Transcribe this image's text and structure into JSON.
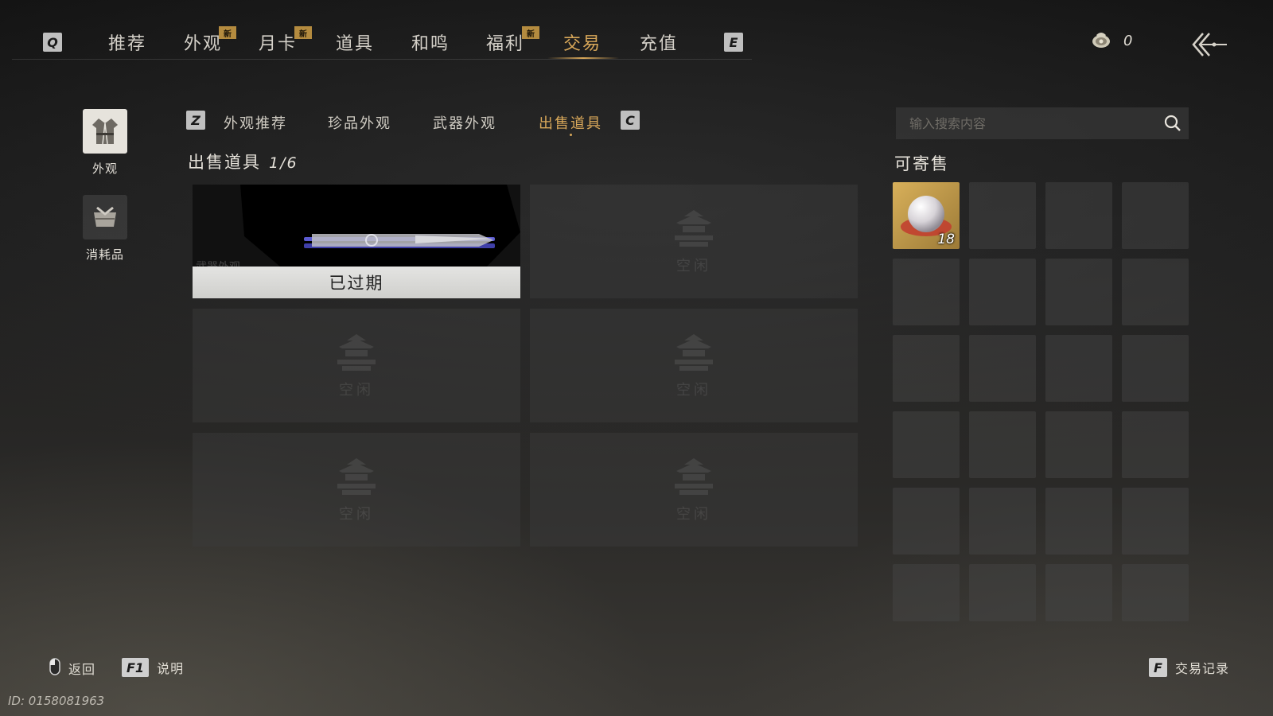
{
  "nav": {
    "left_key": "Q",
    "right_key": "E",
    "tabs": [
      {
        "label": "推荐",
        "badge": ""
      },
      {
        "label": "外观",
        "badge": "新"
      },
      {
        "label": "月卡",
        "badge": "新"
      },
      {
        "label": "道具",
        "badge": ""
      },
      {
        "label": "和鸣",
        "badge": ""
      },
      {
        "label": "福利",
        "badge": "新"
      },
      {
        "label": "交易",
        "badge": ""
      },
      {
        "label": "充值",
        "badge": ""
      }
    ],
    "active_tab": "交易",
    "currency_icon": "coin-pouch-icon",
    "currency_value": "0",
    "back_icon": "back-arrow-icon"
  },
  "sidebar": {
    "items": [
      {
        "label": "外观",
        "icon": "robe-icon",
        "active": true
      },
      {
        "label": "消耗品",
        "icon": "bundle-icon",
        "active": false
      }
    ]
  },
  "subtabs": {
    "left_key": "Z",
    "right_key": "C",
    "items": [
      "外观推荐",
      "珍品外观",
      "武器外观",
      "出售道具"
    ],
    "active": "出售道具"
  },
  "sale": {
    "title": "出售道具",
    "count": "1/6",
    "slots": [
      {
        "status": "已过期",
        "category": "武器外观",
        "image": "weapon-skin-icon"
      },
      {
        "status": "空闲"
      },
      {
        "status": "空闲"
      },
      {
        "status": "空闲"
      },
      {
        "status": "空闲"
      },
      {
        "status": "空闲"
      }
    ],
    "empty_icon": "pavilion-icon"
  },
  "search": {
    "placeholder": "输入搜索内容",
    "value": "",
    "icon": "search-icon"
  },
  "consign": {
    "title": "可寄售",
    "items": [
      {
        "icon": "pearl-icon",
        "quantity": "18"
      }
    ],
    "total_cells": 24
  },
  "footer": {
    "back_label": "返回",
    "back_icon": "mouse-icon",
    "help_key": "F1",
    "help_label": "说明",
    "record_key": "F",
    "record_label": "交易记录",
    "player_id": "ID: 0158081963"
  },
  "colors": {
    "accent": "#d9a85a",
    "badge": "#b48b3f",
    "text": "#d8d4cc"
  }
}
